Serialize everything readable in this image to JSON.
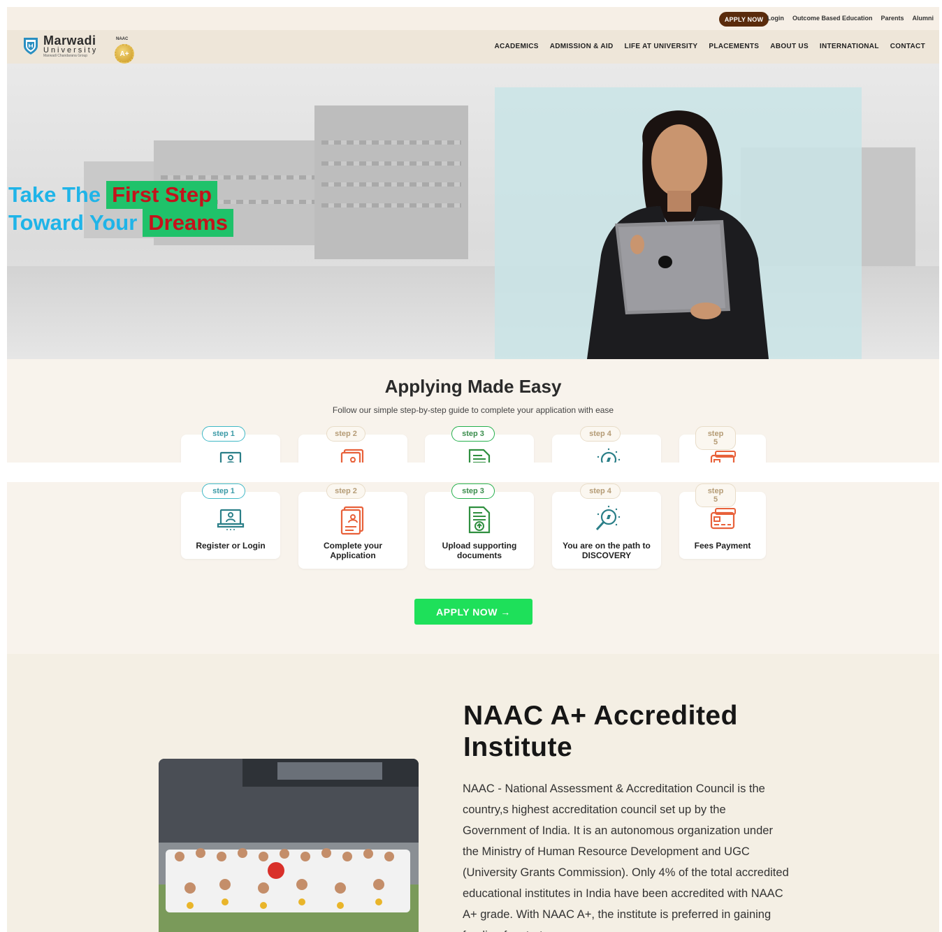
{
  "header": {
    "apply_now": "APPLY NOW",
    "top_links": [
      "Login",
      "Outcome Based Education",
      "Parents",
      "Alumni"
    ],
    "logo": {
      "name": "Marwadi",
      "sub": "University",
      "group": "Marwadi Chandarana Group"
    },
    "naac_label": "NAAC",
    "naac_grade": "A+",
    "nav": [
      "ACADEMICS",
      "ADMISSION & AID",
      "LIFE AT UNIVERSITY",
      "PLACEMENTS",
      "ABOUT US",
      "INTERNATIONAL",
      "CONTACT"
    ]
  },
  "hero": {
    "line1_plain": "Take The",
    "line1_highlight": "First Step",
    "line2_plain": "Toward Your",
    "line2_highlight": "Dreams"
  },
  "steps": {
    "title": "Applying Made Easy",
    "subtitle": "Follow our simple step-by-step guide to complete your application with ease",
    "items": [
      {
        "pill": "step 1",
        "label": "Register or Login",
        "icon": "laptop-user-icon"
      },
      {
        "pill": "step 2",
        "label": "Complete your Application",
        "icon": "application-form-icon"
      },
      {
        "pill": "step 3",
        "label": "Upload supporting documents",
        "icon": "document-upload-icon"
      },
      {
        "pill": "step 4",
        "label": "You are on the path to DISCOVERY",
        "icon": "discovery-search-icon"
      },
      {
        "pill": "step 5",
        "label": "Fees Payment",
        "icon": "payment-card-icon"
      }
    ],
    "cta": "APPLY NOW →"
  },
  "naac": {
    "heading": "NAAC A+ Accredited Institute",
    "body": "NAAC - National Assessment & Accreditation Council is the country,s highest accreditation council set up by the Government of India. It is an autonomous organization under the Ministry of Human Resource Development and UGC (University Grants Commission). Only 4% of the total accredited educational institutes in India have been accredited with NAAC A+ grade. With NAAC A+, the institute is preferred in gaining funding for startups"
  },
  "colors": {
    "brown": "#5a2b0c",
    "cream": "#f8f3ec",
    "hero_blue": "#1fb4e8",
    "highlight_green": "#1fc26a",
    "highlight_red": "#c4121b",
    "cta_green": "#1ee05a",
    "teal": "#3fb8c6",
    "orange": "#e8613a",
    "dark_green": "#2f8f3f"
  }
}
